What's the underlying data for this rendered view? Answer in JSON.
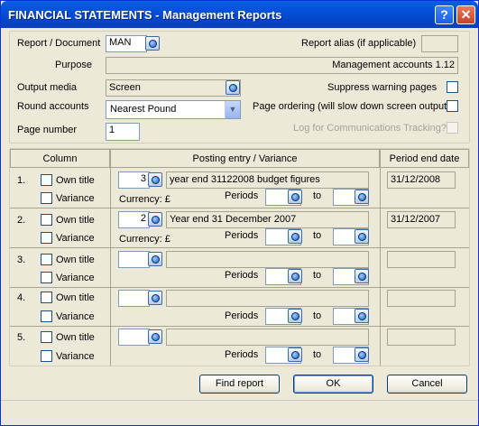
{
  "window": {
    "title": "FINANCIAL STATEMENTS - Management Reports",
    "help_label": "?",
    "close_label": "✕"
  },
  "form": {
    "report_document_label": "Report / Document",
    "report_document_value": "MAN",
    "report_alias_label": "Report alias (if applicable)",
    "report_alias_value": "",
    "purpose_label": "Purpose",
    "purpose_value": "Management accounts 1.12",
    "output_media_label": "Output media",
    "output_media_value": "Screen",
    "suppress_label": "Suppress warning pages",
    "round_label": "Round accounts",
    "round_value": "Nearest Pound",
    "page_ordering_label": "Page ordering (will slow down screen output)",
    "page_number_label": "Page number",
    "page_number_value": "1",
    "log_label": "Log for Communications Tracking?"
  },
  "columns_header": {
    "column": "Column",
    "posting": "Posting entry / Variance",
    "period_end": "Period end date"
  },
  "rows": [
    {
      "num": "1.",
      "own_title": "Own title",
      "variance": "Variance",
      "entry": "3",
      "description": "year end 31122008 budget figures",
      "currency": "Currency: £",
      "periods": "Periods",
      "to": "to",
      "period_end": "31/12/2008"
    },
    {
      "num": "2.",
      "own_title": "Own title",
      "variance": "Variance",
      "entry": "2",
      "description": "Year end 31 December 2007",
      "currency": "Currency: £",
      "periods": "Periods",
      "to": "to",
      "period_end": "31/12/2007"
    },
    {
      "num": "3.",
      "own_title": "Own title",
      "variance": "Variance",
      "entry": "",
      "description": "",
      "currency": "",
      "periods": "Periods",
      "to": "to",
      "period_end": ""
    },
    {
      "num": "4.",
      "own_title": "Own title",
      "variance": "Variance",
      "entry": "",
      "description": "",
      "currency": "",
      "periods": "Periods",
      "to": "to",
      "period_end": ""
    },
    {
      "num": "5.",
      "own_title": "Own title",
      "variance": "Variance",
      "entry": "",
      "description": "",
      "currency": "",
      "periods": "Periods",
      "to": "to",
      "period_end": ""
    }
  ],
  "buttons": {
    "find_report": "Find report",
    "ok": "OK",
    "cancel": "Cancel"
  },
  "icons": {
    "lookup": "lookup-magnifier-icon",
    "dropdown": "chevron-down-icon"
  }
}
